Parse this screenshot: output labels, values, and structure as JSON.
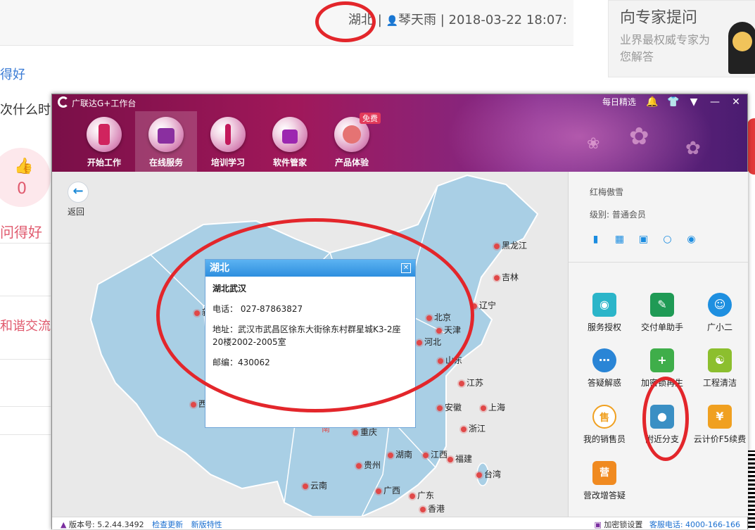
{
  "forum": {
    "location": "湖北",
    "separator1": "|",
    "user": "琴天雨",
    "separator2": "|",
    "datetime": "2018-03-22 18:07:",
    "link_text": "得好",
    "post_text": "次什么时",
    "like_count": "0",
    "good_text": "问得好",
    "circle_text": "和谐交流圈"
  },
  "ad": {
    "title": "向专家提问",
    "subtitle": "业界最权威专家为您解答"
  },
  "app": {
    "title": "广联达G+工作台",
    "daily": "每日精选",
    "nav": [
      {
        "label": "开始工作",
        "icon": "lipstick-icon",
        "active": false
      },
      {
        "label": "在线服务",
        "icon": "handbag-icon",
        "active": true
      },
      {
        "label": "培训学习",
        "icon": "mascara-icon",
        "active": false
      },
      {
        "label": "软件管家",
        "icon": "brushes-icon",
        "active": false
      },
      {
        "label": "产品体验",
        "icon": "compact-icon",
        "active": false,
        "badge": "免费"
      }
    ],
    "back_label": "返回",
    "cities": [
      {
        "name": "黑龙江"
      },
      {
        "name": "吉林"
      },
      {
        "name": "辽宁"
      },
      {
        "name": "北京"
      },
      {
        "name": "天津"
      },
      {
        "name": "河北"
      },
      {
        "name": "山东"
      },
      {
        "name": "江苏"
      },
      {
        "name": "上海"
      },
      {
        "name": "安徽"
      },
      {
        "name": "浙江"
      },
      {
        "name": "重庆"
      },
      {
        "name": "湖南"
      },
      {
        "name": "江西"
      },
      {
        "name": "福建"
      },
      {
        "name": "贵州"
      },
      {
        "name": "台湾"
      },
      {
        "name": "云南"
      },
      {
        "name": "广西"
      },
      {
        "name": "广东"
      },
      {
        "name": "香港"
      },
      {
        "name": "新"
      },
      {
        "name": "西"
      },
      {
        "name": "南"
      }
    ],
    "popup": {
      "header": "湖北",
      "name": "湖北武汉",
      "phone": "电话： 027-87863827",
      "address": "地址：武汉市武昌区徐东大街徐东村群星城K3-2座20楼2002-2005室",
      "postcode": "邮编：430062"
    },
    "side": {
      "username": "红梅傲雪",
      "level": "级别: 普通会员",
      "tools": [
        {
          "label": "服务授权",
          "icon": "lock-icon",
          "color": "#2bb5c9"
        },
        {
          "label": "交付单助手",
          "icon": "document-icon",
          "color": "#1f9a55"
        },
        {
          "label": "广小二",
          "icon": "mascot-icon",
          "color": "#1e8fe0"
        },
        {
          "label": "答疑解惑",
          "icon": "chat-icon",
          "color": "#2a85d6"
        },
        {
          "label": "加密锁再生",
          "icon": "usb-key-icon",
          "color": "#3fae4a"
        },
        {
          "label": "工程清洁",
          "icon": "broom-icon",
          "color": "#8cbf2e"
        },
        {
          "label": "我的销售员",
          "icon": "sales-icon",
          "color": "#f0a020"
        },
        {
          "label": "附近分支",
          "icon": "map-pin-icon",
          "color": "#3a8fc4"
        },
        {
          "label": "云计价F5续费",
          "icon": "renew-icon",
          "color": "#f0a020"
        },
        {
          "label": "营改增答疑",
          "icon": "tax-icon",
          "color": "#f08a20"
        }
      ]
    },
    "status": {
      "version_label": "版本号:",
      "version": "5.2.44.3492",
      "check_update": "检查更新",
      "new_features": "新版特性",
      "lock_settings": "加密锁设置",
      "hotline": "客服电话: 4000-166-166"
    }
  }
}
